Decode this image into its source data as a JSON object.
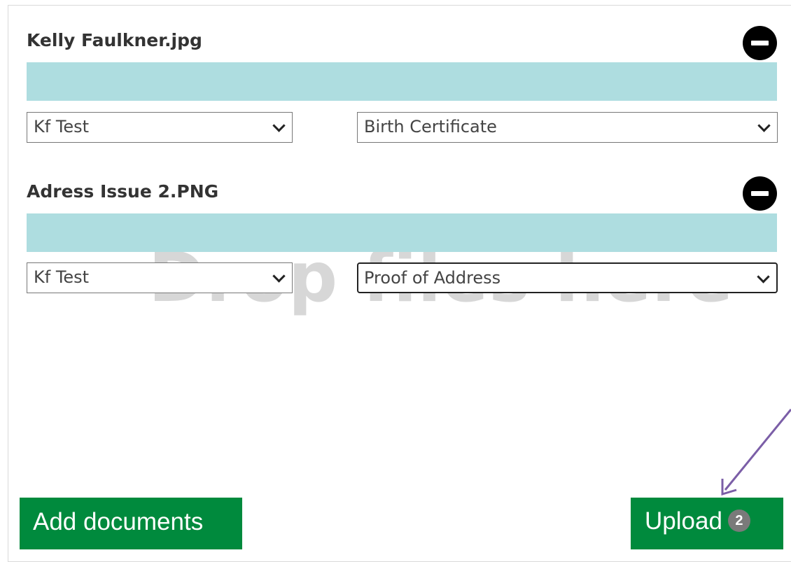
{
  "dropzone": {
    "hint": "Drop files here"
  },
  "files": [
    {
      "name": "Kelly Faulkner.jpg",
      "owner": "Kf Test",
      "doc_type": "Birth Certificate"
    },
    {
      "name": "Adress Issue 2.PNG",
      "owner": "Kf Test",
      "doc_type": "Proof of Address"
    }
  ],
  "actions": {
    "add_label": "Add documents",
    "upload_label": "Upload",
    "upload_count": "2"
  },
  "colors": {
    "primary": "#008a3d",
    "progress": "#aedde0",
    "annotation_arrow": "#7b5ea7"
  },
  "icons": {
    "remove": "minus-circle-icon",
    "dropdown": "chevron-down-icon"
  }
}
